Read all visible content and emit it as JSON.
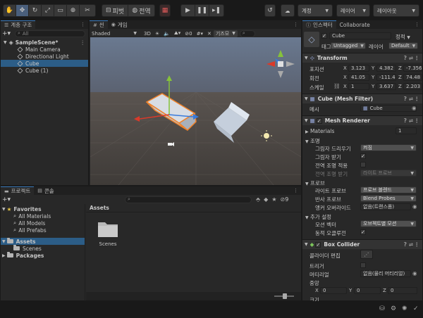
{
  "toolbar": {
    "pivot_label": "피벗",
    "global_label": "전역",
    "layers_label": "계정",
    "layer_dropdown": "레이어",
    "layout_dropdown": "레이아웃"
  },
  "hierarchy": {
    "tab": "계층 구조",
    "search_placeholder": "All",
    "scene_name": "SampleScene*",
    "items": [
      {
        "label": "Main Camera"
      },
      {
        "label": "Directional Light"
      },
      {
        "label": "Cube"
      },
      {
        "label": "Cube (1)"
      }
    ]
  },
  "scene": {
    "tab_scene": "씬",
    "tab_game": "게임",
    "shading": "Shaded",
    "mode_2d": "3D",
    "gizmos": "기즈모",
    "hidden_count": "0",
    "search_placeholder": "All"
  },
  "project": {
    "tab_project": "프로젝트",
    "tab_console": "콘솔",
    "favorites": "Favorites",
    "fav_items": [
      "All Materials",
      "All Models",
      "All Prefabs"
    ],
    "assets": "Assets",
    "assets_children": [
      "Scenes"
    ],
    "packages": "Packages",
    "breadcrumb": "Assets",
    "folder_label": "Scenes",
    "count_badge": "9"
  },
  "inspector": {
    "tab_inspector": "인스펙터",
    "tab_collab": "Collaborate",
    "object_name": "Cube",
    "static_label": "정적",
    "tag_label": "태그",
    "tag_value": "Untagged",
    "layer_label": "레이어",
    "layer_value": "Default",
    "transform": {
      "title": "Transform",
      "position_label": "포지션",
      "rotation_label": "회전",
      "scale_label": "스케일",
      "position": {
        "x": "3.123",
        "y": "4.382",
        "z": "-7.356"
      },
      "rotation": {
        "x": "41.05",
        "y": "-111.4",
        "z": "74.48"
      },
      "scale": {
        "x": "1",
        "y": "3.637",
        "z": "2.203"
      }
    },
    "mesh_filter": {
      "title": "Cube (Mesh Filter)",
      "mesh_label": "메시",
      "mesh_value": "Cube"
    },
    "mesh_renderer": {
      "title": "Mesh Renderer",
      "materials_label": "Materials",
      "materials_count": "1",
      "lighting_label": "조명",
      "cast_shadows_label": "그림자 드리우기",
      "cast_shadows_value": "켜짐",
      "receive_shadows_label": "그림자 받기",
      "contribute_gi_label": "전역 조명 적용",
      "receive_gi_label": "전역 조명 받기",
      "receive_gi_value": "라이트 프로브",
      "probes_label": "프로브",
      "light_probes_label": "라이트 프로브",
      "light_probes_value": "프로브 블렌드",
      "reflection_probes_label": "반사 프로브",
      "reflection_probes_value": "Blend Probes",
      "anchor_override_label": "앵커 오버라이드",
      "anchor_override_value": "없음(트랜스폼)",
      "additional_label": "추가 설정",
      "motion_vectors_label": "모션 벡터",
      "motion_vectors_value": "오브젝트별 모션",
      "dynamic_occlusion_label": "동적 오클루전"
    },
    "box_collider": {
      "title": "Box Collider",
      "edit_collider_label": "콜라이더 편집",
      "is_trigger_label": "트리거",
      "material_label": "머티리얼",
      "material_value": "없음(물리 머티리얼)",
      "center_label": "중앙",
      "center": {
        "x": "0",
        "y": "0",
        "z": "0"
      },
      "size_label": "크기"
    }
  },
  "colors": {
    "selection": "#2c5d87",
    "cube_outline": "#f0822a",
    "sky": "#5f6c80",
    "ground": "#4b4642",
    "gizmo_x": "#d93a2a",
    "gizmo_y": "#86c23a",
    "gizmo_z": "#3a7ad9"
  }
}
